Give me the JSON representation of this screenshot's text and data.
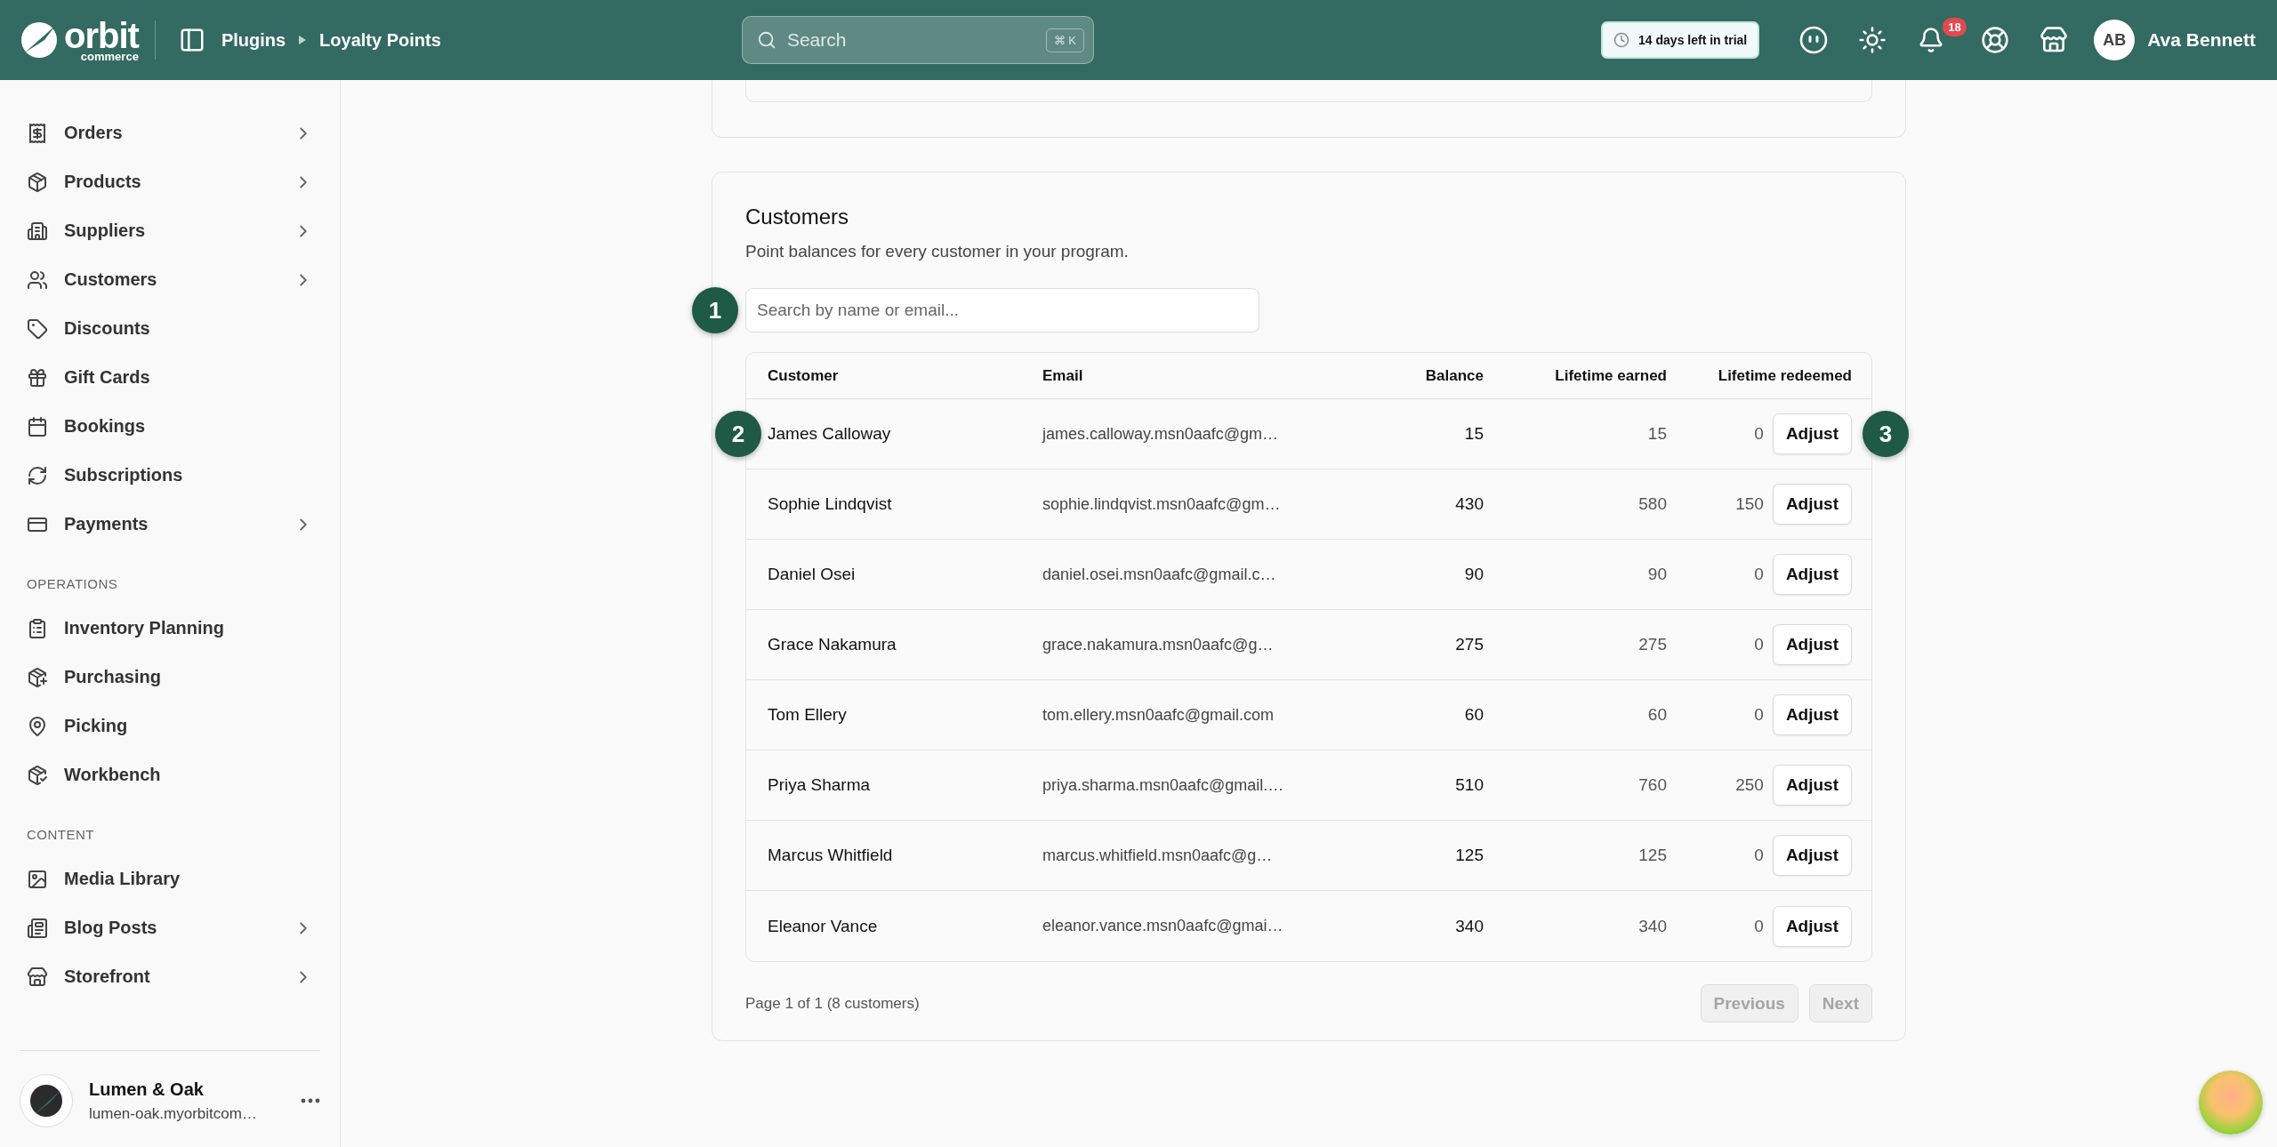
{
  "header": {
    "logo": {
      "wordmark": "orbit",
      "tagline": "commerce"
    },
    "breadcrumbs": [
      {
        "label": "Plugins"
      },
      {
        "label": "Loyalty Points"
      }
    ],
    "search": {
      "placeholder": "Search",
      "shortcut": "⌘ K"
    },
    "trial_badge": "14 days left in trial",
    "notifications_count": "18",
    "user": {
      "initials": "AB",
      "name": "Ava Bennett"
    }
  },
  "sidebar": {
    "sections": [
      {
        "items": [
          {
            "label": "Orders",
            "expandable": true
          },
          {
            "label": "Products",
            "expandable": true
          },
          {
            "label": "Suppliers",
            "expandable": true
          },
          {
            "label": "Customers",
            "expandable": true
          },
          {
            "label": "Discounts",
            "expandable": false
          },
          {
            "label": "Gift Cards",
            "expandable": false
          },
          {
            "label": "Bookings",
            "expandable": false
          },
          {
            "label": "Subscriptions",
            "expandable": false
          },
          {
            "label": "Payments",
            "expandable": true
          }
        ]
      },
      {
        "heading": "OPERATIONS",
        "items": [
          {
            "label": "Inventory Planning",
            "expandable": false
          },
          {
            "label": "Purchasing",
            "expandable": false
          },
          {
            "label": "Picking",
            "expandable": false
          },
          {
            "label": "Workbench",
            "expandable": false
          }
        ]
      },
      {
        "heading": "CONTENT",
        "items": [
          {
            "label": "Media Library",
            "expandable": false
          },
          {
            "label": "Blog Posts",
            "expandable": true
          },
          {
            "label": "Storefront",
            "expandable": true
          }
        ]
      }
    ],
    "store": {
      "name": "Lumen & Oak",
      "url": "lumen-oak.myorbitcom…"
    }
  },
  "customers_card": {
    "title": "Customers",
    "subtitle": "Point balances for every customer in your program.",
    "search": {
      "placeholder": "Search by name or email...",
      "marker": "1"
    },
    "columns": [
      "Customer",
      "Email",
      "Balance",
      "Lifetime earned",
      "Lifetime redeemed"
    ],
    "rows": [
      {
        "customer": "James Calloway",
        "email": "james.calloway.msn0aafc@gm…",
        "balance": "15",
        "earned": "15",
        "redeemed": "0",
        "action": "Adjust",
        "marker": "2",
        "action_marker": "3"
      },
      {
        "customer": "Sophie Lindqvist",
        "email": "sophie.lindqvist.msn0aafc@gm…",
        "balance": "430",
        "earned": "580",
        "redeemed": "150",
        "action": "Adjust"
      },
      {
        "customer": "Daniel Osei",
        "email": "daniel.osei.msn0aafc@gmail.c…",
        "balance": "90",
        "earned": "90",
        "redeemed": "0",
        "action": "Adjust"
      },
      {
        "customer": "Grace Nakamura",
        "email": "grace.nakamura.msn0aafc@g…",
        "balance": "275",
        "earned": "275",
        "redeemed": "0",
        "action": "Adjust"
      },
      {
        "customer": "Tom Ellery",
        "email": "tom.ellery.msn0aafc@gmail.com",
        "balance": "60",
        "earned": "60",
        "redeemed": "0",
        "action": "Adjust"
      },
      {
        "customer": "Priya Sharma",
        "email": "priya.sharma.msn0aafc@gmail.…",
        "balance": "510",
        "earned": "760",
        "redeemed": "250",
        "action": "Adjust"
      },
      {
        "customer": "Marcus Whitfield",
        "email": "marcus.whitfield.msn0aafc@g…",
        "balance": "125",
        "earned": "125",
        "redeemed": "0",
        "action": "Adjust"
      },
      {
        "customer": "Eleanor Vance",
        "email": "eleanor.vance.msn0aafc@gmai…",
        "balance": "340",
        "earned": "340",
        "redeemed": "0",
        "action": "Adjust"
      }
    ],
    "page_info": "Page 1 of 1 (8 customers)",
    "pagination": {
      "previous": {
        "label": "Previous",
        "disabled": true
      },
      "next": {
        "label": "Next",
        "disabled": true
      }
    }
  }
}
